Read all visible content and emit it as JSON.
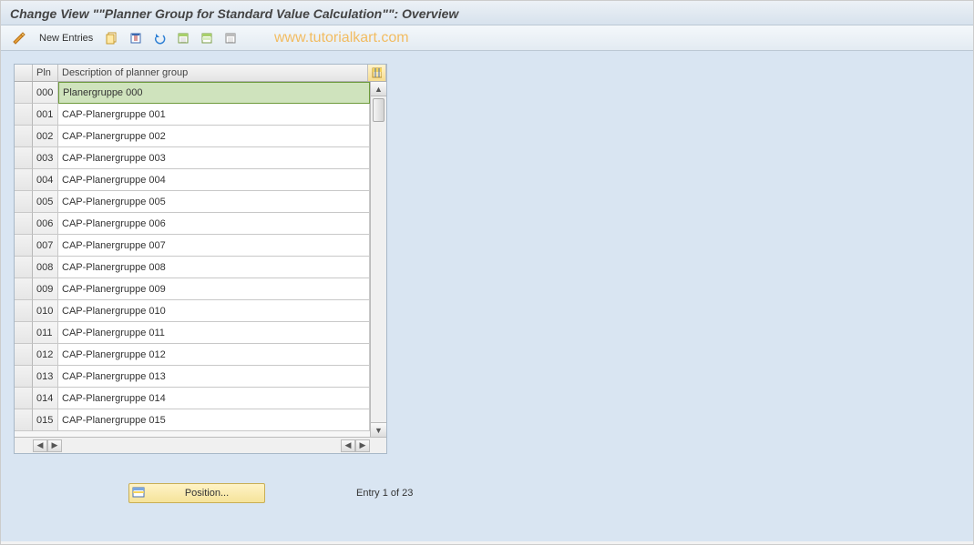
{
  "title": "Change View \"\"Planner Group for Standard Value Calculation\"\": Overview",
  "watermark": "www.tutorialkart.com",
  "toolbar": {
    "new_entries": "New Entries"
  },
  "table": {
    "col_pln": "Pln",
    "col_desc": "Description of planner group",
    "rows": [
      {
        "pln": "000",
        "desc": "Planergruppe 000",
        "selected": true
      },
      {
        "pln": "001",
        "desc": "CAP-Planergruppe 001"
      },
      {
        "pln": "002",
        "desc": "CAP-Planergruppe 002"
      },
      {
        "pln": "003",
        "desc": "CAP-Planergruppe 003"
      },
      {
        "pln": "004",
        "desc": "CAP-Planergruppe 004"
      },
      {
        "pln": "005",
        "desc": "CAP-Planergruppe 005"
      },
      {
        "pln": "006",
        "desc": "CAP-Planergruppe 006"
      },
      {
        "pln": "007",
        "desc": "CAP-Planergruppe 007"
      },
      {
        "pln": "008",
        "desc": "CAP-Planergruppe 008"
      },
      {
        "pln": "009",
        "desc": "CAP-Planergruppe 009"
      },
      {
        "pln": "010",
        "desc": "CAP-Planergruppe 010"
      },
      {
        "pln": "011",
        "desc": "CAP-Planergruppe 011"
      },
      {
        "pln": "012",
        "desc": "CAP-Planergruppe 012"
      },
      {
        "pln": "013",
        "desc": "CAP-Planergruppe 013"
      },
      {
        "pln": "014",
        "desc": "CAP-Planergruppe 014"
      },
      {
        "pln": "015",
        "desc": "CAP-Planergruppe 015"
      }
    ]
  },
  "footer": {
    "position_label": "Position...",
    "entry_label": "Entry 1 of 23"
  }
}
